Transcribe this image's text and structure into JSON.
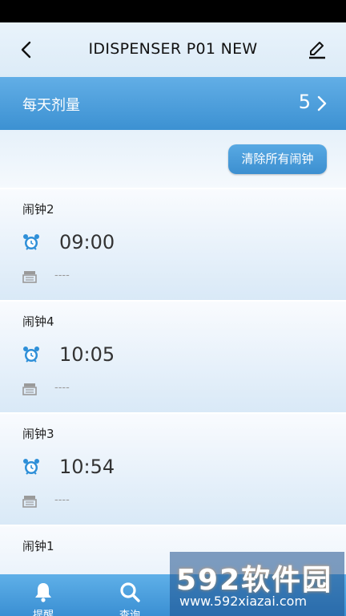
{
  "header": {
    "title": "IDISPENSER P01 NEW",
    "back_icon": "chevron-left-icon",
    "edit_icon": "pencil-icon"
  },
  "dose": {
    "label": "每天剂量",
    "value": "5"
  },
  "actions": {
    "clear_all": "清除所有闹钟"
  },
  "alarms": [
    {
      "name": "闹钟2",
      "time": "09:00",
      "drug": "----"
    },
    {
      "name": "闹钟4",
      "time": "10:05",
      "drug": "----"
    },
    {
      "name": "闹钟3",
      "time": "10:54",
      "drug": "----"
    },
    {
      "name": "闹钟1",
      "time": "",
      "drug": ""
    }
  ],
  "tabs": [
    {
      "label": "提醒",
      "icon": "bell-icon"
    },
    {
      "label": "查询",
      "icon": "search-icon"
    },
    {
      "label": "",
      "icon": ""
    },
    {
      "label": "",
      "icon": ""
    }
  ],
  "watermark": {
    "title": "592软件园",
    "url": "www.592xiazai.com"
  },
  "colors": {
    "accent": "#3c91d2",
    "accent_light": "#62aee6",
    "header_bg": "#e3eff9",
    "alarm_icon": "#2e8fd8"
  }
}
